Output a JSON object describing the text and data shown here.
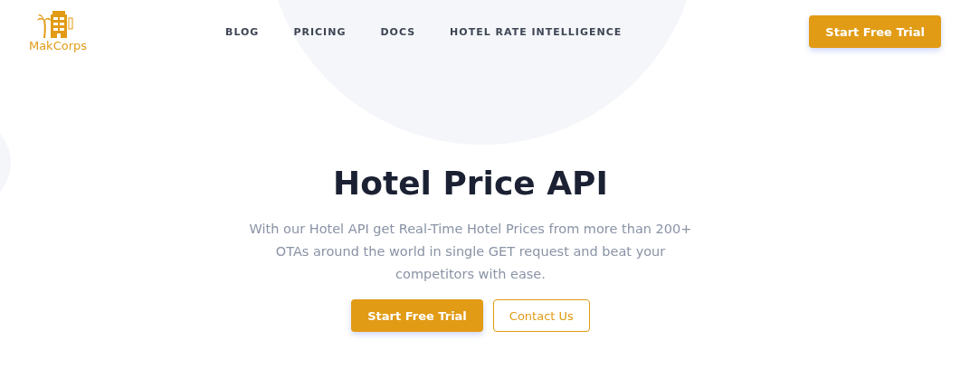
{
  "logo": {
    "text": "MakCorps"
  },
  "nav": [
    {
      "label": "BLOG"
    },
    {
      "label": "PRICING"
    },
    {
      "label": "DOCS"
    },
    {
      "label": "HOTEL RATE INTELLIGENCE"
    }
  ],
  "header_button": "Start Free Trial",
  "hero": {
    "title": "Hotel Price API",
    "description": "With our Hotel API get Real-Time Hotel Prices from more than 200+ OTAs around the world in single GET request and beat your competitors with ease.",
    "buttons": [
      {
        "label": "Start Free Trial",
        "kind": "primary"
      },
      {
        "label": "Contact Us",
        "kind": "outline"
      }
    ]
  }
}
